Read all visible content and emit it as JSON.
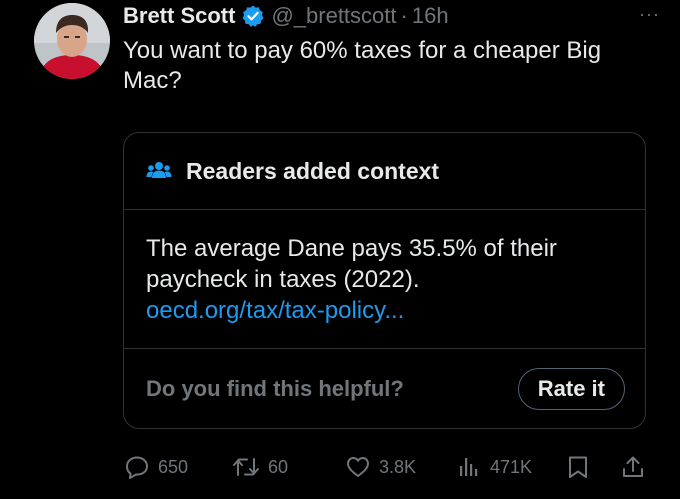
{
  "tweet": {
    "author_name": "Brett Scott",
    "handle": "@_brettscott",
    "separator": "·",
    "time": "16h",
    "text": "You want to pay 60% taxes for a cheaper Big Mac?",
    "more_label": "···",
    "verified": true
  },
  "community_note": {
    "title": "Readers added context",
    "icon": "people-icon",
    "body": "The average Dane pays 35.5% of their paycheck in taxes (2022).",
    "link": "oecd.org/tax/tax-policy...",
    "helpful_question": "Do you find this helpful?",
    "rate_button": "Rate it"
  },
  "actions": {
    "replies": "650",
    "retweets": "60",
    "likes": "3.8K",
    "views": "471K"
  },
  "colors": {
    "background": "#000000",
    "text": "#e7e9ea",
    "muted": "#71767b",
    "accent": "#1d9bf0",
    "border": "#2f3336",
    "verified_badge": "#1d9bf0"
  }
}
